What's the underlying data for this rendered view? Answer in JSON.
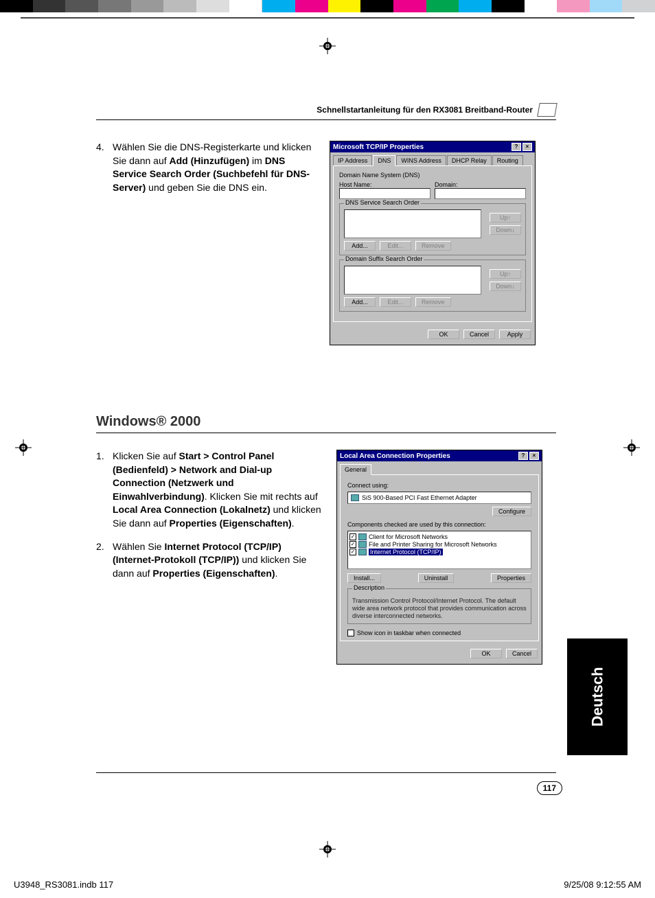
{
  "colorbar": [
    "#000",
    "#333",
    "#555",
    "#777",
    "#999",
    "#bbb",
    "#ddd",
    "#fff",
    "#00adee",
    "#ec008b",
    "#fff200",
    "#000",
    "#ec008b",
    "#00a550",
    "#00adee",
    "#000",
    "#fff",
    "#f598c0",
    "#87d3e2",
    "#d0d2d3"
  ],
  "header": {
    "title": "Schnellstartanleitung für den RX3081 Breitband-Router"
  },
  "step4": {
    "num": "4.",
    "t1": "Wählen Sie die DNS-Registerkarte und klicken Sie dann auf ",
    "b1": "Add (Hinzufügen)",
    "t2": " im ",
    "b2": "DNS Service Search Order (Suchbefehl für DNS-Server)",
    "t3": " und geben Sie die DNS ein."
  },
  "dlg1": {
    "title": "Microsoft TCP/IP Properties",
    "tabs": [
      "IP Address",
      "DNS",
      "WINS Address",
      "DHCP Relay",
      "Routing"
    ],
    "active_tab": 1,
    "dns_legend": "Domain Name System (DNS)",
    "host": "Host Name:",
    "domain": "Domain:",
    "sso_legend": "DNS Service Search Order",
    "up": "Up↑",
    "down": "Down↓",
    "add": "Add...",
    "edit": "Edit...",
    "remove": "Remove",
    "suffix_legend": "Domain Suffix Search Order",
    "ok": "OK",
    "cancel": "Cancel",
    "apply": "Apply"
  },
  "win2k_heading": "Windows® 2000",
  "step1": {
    "num": "1.",
    "t1": "Klicken Sie auf ",
    "b1": "Start > Control Panel (Bedienfeld) > Network and Dial-up Connection (Netzwerk und Einwahlverbindung)",
    "t2": ". Klicken Sie mit rechts auf ",
    "b2": "Local Area Connection (Lokalnetz)",
    "t3": " und klicken Sie dann auf ",
    "b3": "Properties (Eigenschaften)",
    "t4": "."
  },
  "step2": {
    "num": "2.",
    "t1": "Wählen Sie ",
    "b1": "Internet Protocol (TCP/IP) (Internet-Protokoll (TCP/IP))",
    "t2": " und klicken Sie dann auf ",
    "b2": "Properties (Eigenschaften)",
    "t3": "."
  },
  "dlg2": {
    "title": "Local Area Connection Properties",
    "tab": "General",
    "connect_using": "Connect using:",
    "adapter": "SiS 900-Based PCI Fast Ethernet Adapter",
    "configure": "Configure",
    "checked_label": "Components checked are used by this connection:",
    "items": [
      {
        "checked": true,
        "label": "Client for Microsoft Networks",
        "selected": false
      },
      {
        "checked": true,
        "label": "File and Printer Sharing for Microsoft Networks",
        "selected": false
      },
      {
        "checked": true,
        "label": "Internet Protocol (TCP/IP)",
        "selected": true
      }
    ],
    "install": "Install...",
    "uninstall": "Uninstall",
    "properties": "Properties",
    "desc_legend": "Description",
    "desc": "Transmission Control Protocol/Internet Protocol. The default wide area network protocol that provides communication across diverse interconnected networks.",
    "show_icon": "Show icon in taskbar when connected",
    "ok": "OK",
    "cancel": "Cancel"
  },
  "lang": "Deutsch",
  "page_num": "117",
  "footer": {
    "left": "U3948_RS3081.indb   117",
    "right": "9/25/08   9:12:55 AM"
  }
}
